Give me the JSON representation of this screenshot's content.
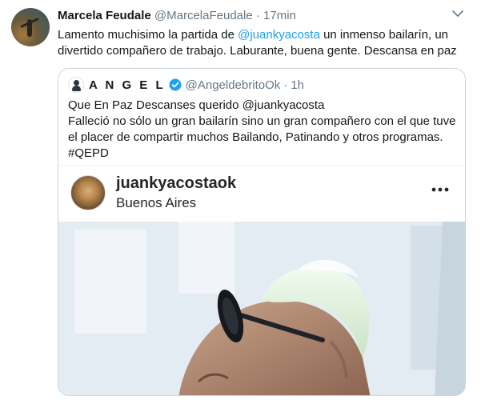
{
  "tweet": {
    "author_name": "Marcela Feudale",
    "author_handle": "@MarcelaFeudale",
    "separator": "·",
    "time": "17min",
    "text_before_mention": "Lamento muchisimo la partida de ",
    "mention": "@juankyacosta",
    "text_after_mention": " un inmenso bailarín, un divertido compañero de trabajo. Laburante, buena gente. Descansa en paz"
  },
  "quote": {
    "author_name": "A N G E L",
    "author_handle": "@AngeldebritoOk",
    "separator": "·",
    "time": "1h",
    "line1": "Que En Paz Descanses querido @juankyacosta",
    "line2": "Falleció no sólo un gran bailarín sino un gran compañero con el que tuve",
    "line3": "el placer de compartir muchos Bailando, Patinando y otros programas.",
    "line4": "#QEPD"
  },
  "instagram": {
    "username": "juankyacostaok",
    "location": "Buenos Aires"
  },
  "colors": {
    "link": "#1da1f2",
    "muted": "#657786",
    "border": "#ccd6dd",
    "verified": "#1da1f2"
  },
  "icons": [
    "chevron-down-icon",
    "verified-badge-icon",
    "more-options-icon"
  ]
}
